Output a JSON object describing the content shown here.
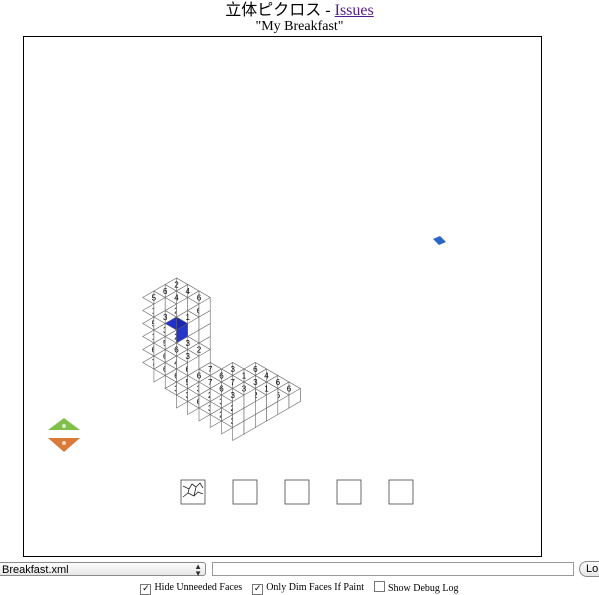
{
  "header": {
    "title": "立体ピクロス",
    "separator": "-",
    "issues_link": "Issues",
    "puzzle_name": "\"My Breakfast\""
  },
  "puzzle": {
    "clue_numbers": [
      "7",
      "7",
      "6",
      "6",
      "7",
      "3",
      "3",
      "5",
      "3",
      "3",
      "3",
      "2",
      "2",
      "6",
      "6",
      "3",
      "3",
      "3",
      "2",
      "2",
      "1",
      "2",
      "3",
      "3",
      "2",
      "1",
      "1",
      "6",
      "5",
      "6",
      "2",
      "4",
      "4",
      "6",
      "6",
      "6",
      "6",
      "6",
      "6",
      "6"
    ]
  },
  "palette": {
    "selected_cube_color": "#1f2fd0",
    "add_color": "#7fbf4a",
    "remove_color": "#d97a3a",
    "slider_color": "#2a66c4"
  },
  "brush_slots": {
    "count": 5,
    "selected_index": 0
  },
  "bottom_bar": {
    "file_select_value": "Breakfast.xml",
    "text_input_value": "",
    "load_button_label": "Lo"
  },
  "options": [
    {
      "label": "Hide Unneeded Faces",
      "checked": true
    },
    {
      "label": "Only Dim Faces If Paint",
      "checked": true
    },
    {
      "label": "Show Debug Log",
      "checked": false
    }
  ]
}
